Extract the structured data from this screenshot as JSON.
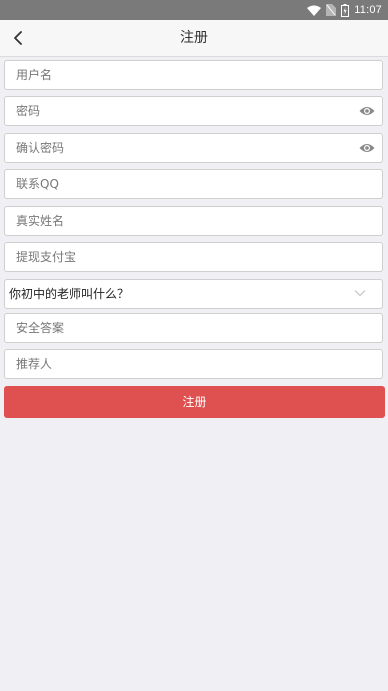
{
  "status_bar": {
    "time": "11:07"
  },
  "nav": {
    "title": "注册"
  },
  "form": {
    "username_placeholder": "用户名",
    "password_placeholder": "密码",
    "confirm_password_placeholder": "确认密码",
    "qq_placeholder": "联系QQ",
    "realname_placeholder": "真实姓名",
    "alipay_placeholder": "提现支付宝",
    "security_question": "你初中的老师叫什么？",
    "security_answer_placeholder": "安全答案",
    "referrer_placeholder": "推荐人"
  },
  "submit_label": "注册",
  "colors": {
    "accent": "#df5050",
    "background": "#efeff4"
  }
}
